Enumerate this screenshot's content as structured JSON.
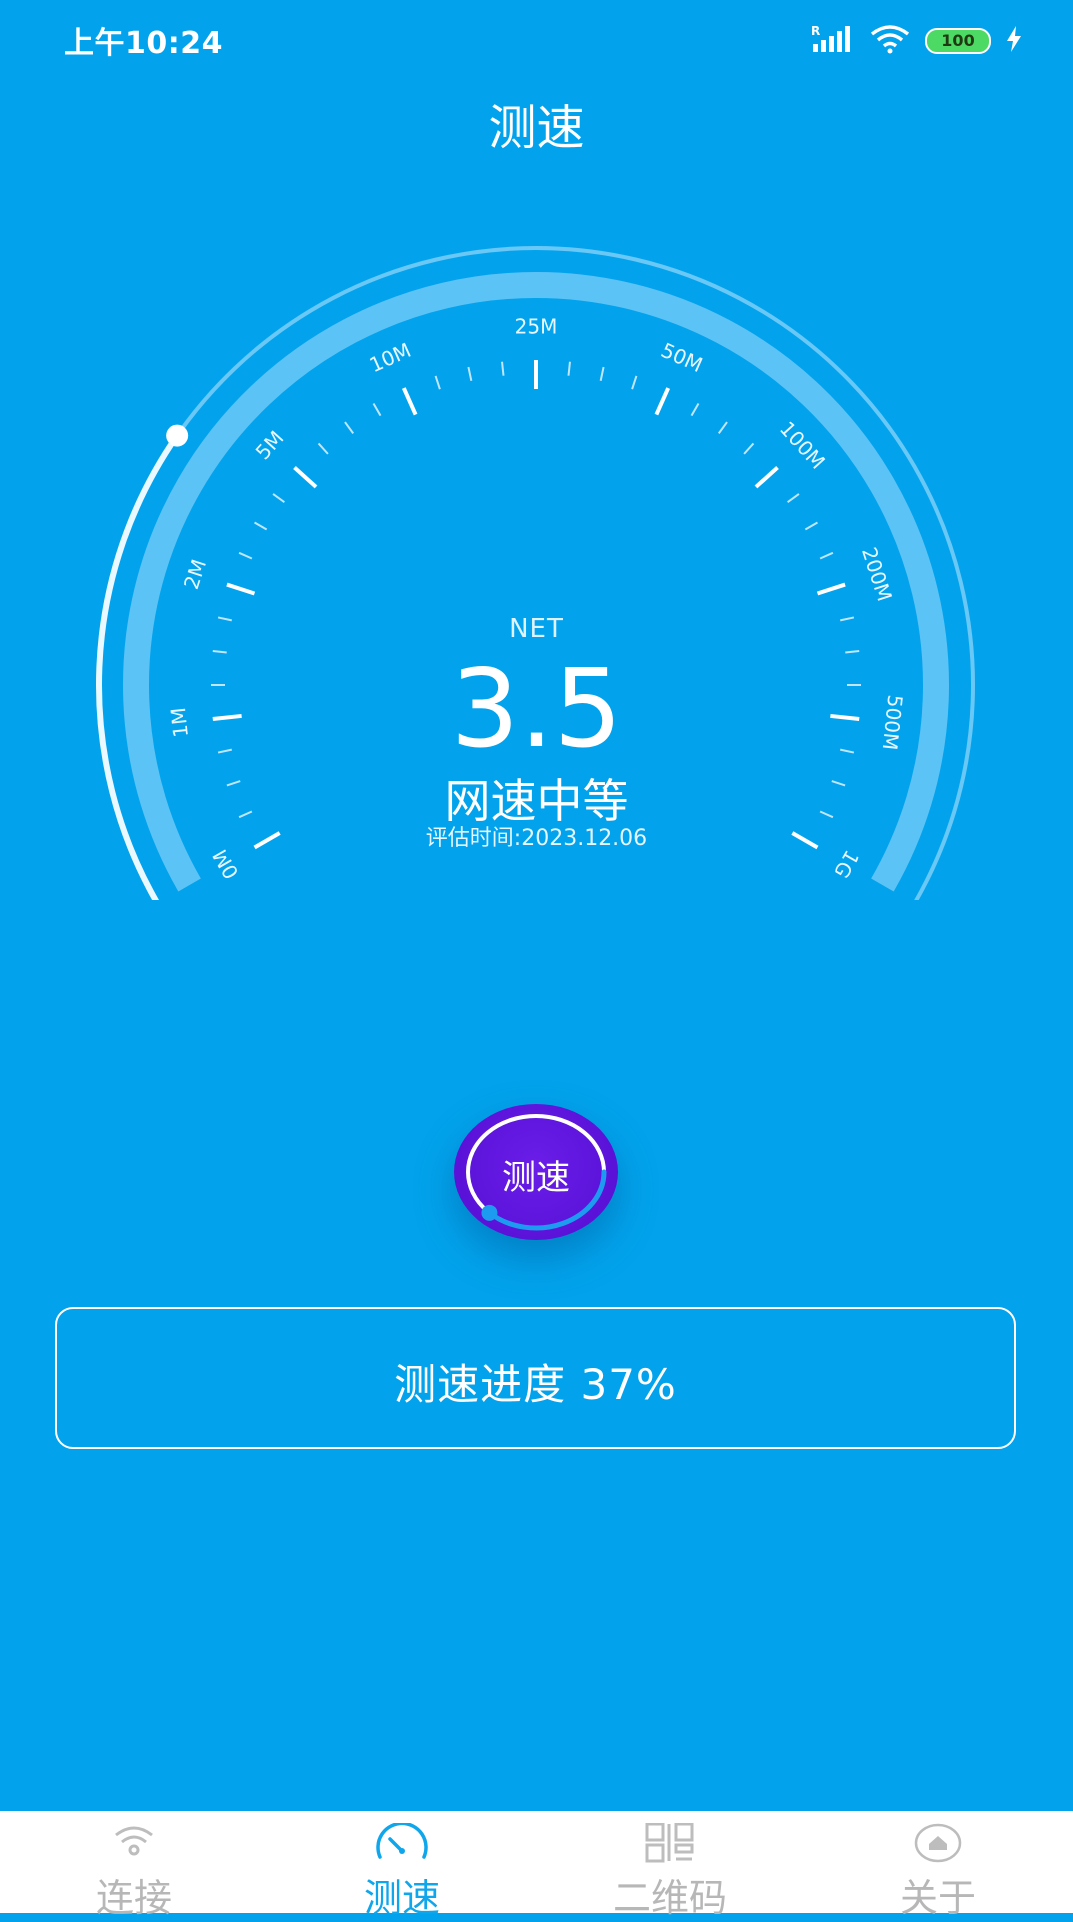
{
  "status_bar": {
    "time": "上午10:24",
    "signal_icon": "signal-roaming-icon",
    "wifi_icon": "wifi-icon",
    "battery": "100",
    "charging_icon": "charging-bolt-icon"
  },
  "header": {
    "title": "测速"
  },
  "gauge": {
    "scale_labels": [
      "0M",
      "1M",
      "2M",
      "5M",
      "10M",
      "25M",
      "50M",
      "100M",
      "200M",
      "500M",
      "1G"
    ],
    "net_label": "NET",
    "speed_value": "3.5",
    "speed_level": "网速中等",
    "eval_time": "评估时间:2023.12.06",
    "indicator_fraction": 0.27
  },
  "test_button": {
    "label": "测速",
    "progress_fraction": 0.37
  },
  "progress": {
    "text": "测速进度  37%"
  },
  "tabs": [
    {
      "label": "连接",
      "icon": "wifi-icon",
      "active": false
    },
    {
      "label": "测速",
      "icon": "speedometer-icon",
      "active": true
    },
    {
      "label": "二维码",
      "icon": "qr-code-icon",
      "active": false
    },
    {
      "label": "关于",
      "icon": "home-icon",
      "active": false
    }
  ],
  "colors": {
    "background": "#02a3ec",
    "button": "#5a12d8",
    "active_tab": "#10a6ec",
    "inactive_tab": "#b7b7b7"
  }
}
